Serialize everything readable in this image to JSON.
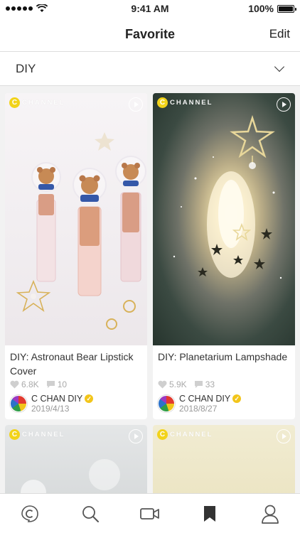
{
  "status_bar": {
    "time": "9:41 AM",
    "battery": "100%",
    "battery_level": 1.0
  },
  "header": {
    "title": "Favorite",
    "edit_label": "Edit"
  },
  "category": {
    "selected": "DIY"
  },
  "channel_logo": {
    "letter": "C",
    "text": "CHANNEL"
  },
  "cards": [
    {
      "title": "DIY: Astronaut Bear Lipstick Cover",
      "likes": "6.8K",
      "comments": "10",
      "author": "C CHAN DIY",
      "date": "2019/4/13"
    },
    {
      "title": "DIY: Planetarium Lampshade",
      "likes": "5.9K",
      "comments": "33",
      "author": "C CHAN DIY",
      "date": "2018/8/27"
    }
  ],
  "icons": {
    "tabs": [
      "home-icon",
      "search-icon",
      "video-icon",
      "bookmark-icon",
      "profile-icon"
    ]
  },
  "colors": {
    "brand_yellow": "#f2d31a",
    "active_tab": "#333333"
  }
}
